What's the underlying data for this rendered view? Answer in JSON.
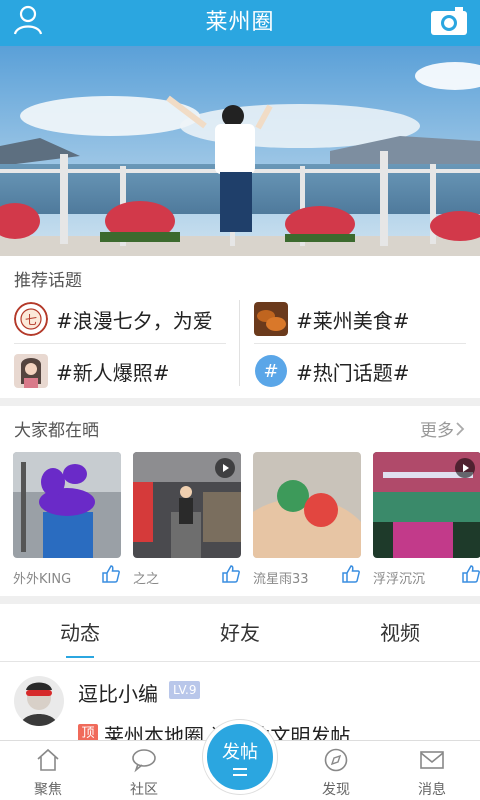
{
  "header": {
    "title": "莱州圈",
    "user_icon": "user-icon",
    "camera_icon": "camera-icon"
  },
  "topics": {
    "title": "推荐话题",
    "items": [
      {
        "label": "#浪漫七夕，为爱",
        "icon": "qixi-icon"
      },
      {
        "label": "#莱州美食#",
        "icon": "food-icon"
      },
      {
        "label": "#新人爆照#",
        "icon": "newbie-icon"
      },
      {
        "label": "#热门话题#",
        "icon": "hashtag-icon"
      }
    ]
  },
  "sharing": {
    "title": "大家都在晒",
    "more": "更多",
    "cards": [
      {
        "user": "外外KING",
        "video": false
      },
      {
        "user": "之之",
        "video": true
      },
      {
        "user": "流星雨33",
        "video": false
      },
      {
        "user": "浮浮沉沉",
        "video": true
      }
    ]
  },
  "tabs": [
    "动态",
    "好友",
    "视频"
  ],
  "feed": {
    "poster": "逗比小编",
    "level": "LV.9",
    "tag": "顶",
    "text": "莱州本地圈 请各位文明发帖"
  },
  "bottomnav": {
    "items": [
      {
        "label": "聚焦",
        "icon": "home-icon"
      },
      {
        "label": "社区",
        "icon": "chat-icon"
      },
      {
        "label": "发现",
        "icon": "compass-icon"
      },
      {
        "label": "消息",
        "icon": "mail-icon"
      }
    ],
    "post_label": "发帖"
  },
  "colors": {
    "accent": "#2ba6e0"
  }
}
